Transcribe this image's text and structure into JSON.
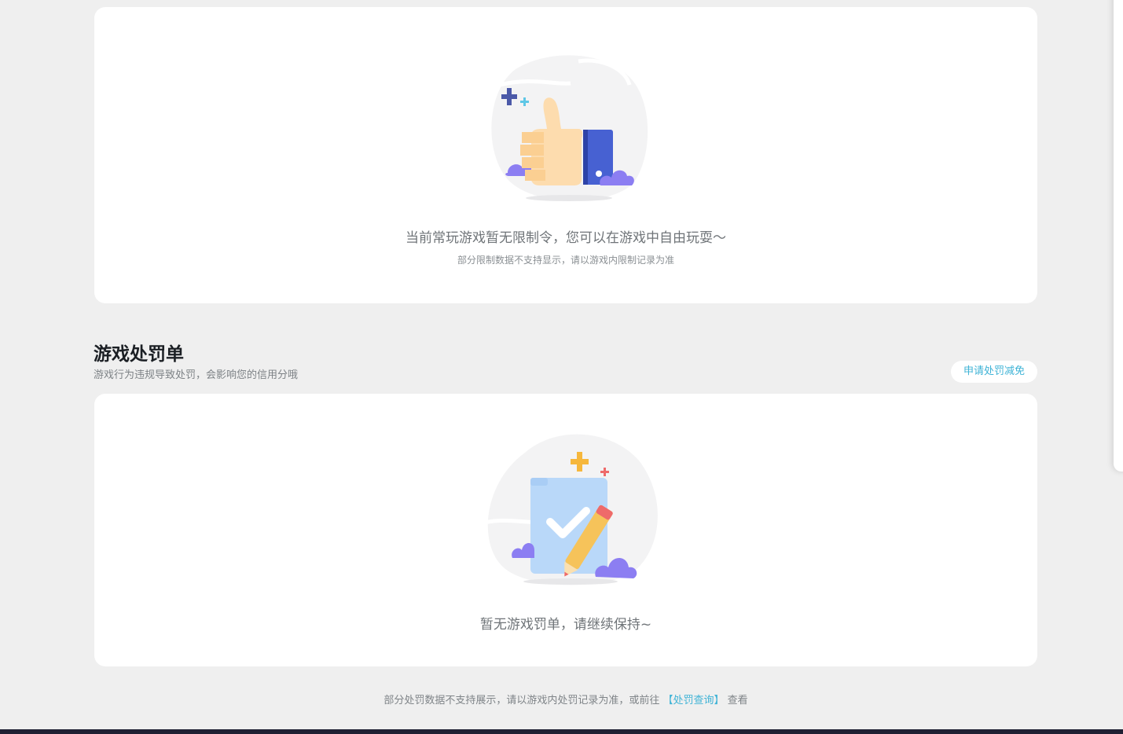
{
  "restriction_card": {
    "illustration": "thumbs-up-illustration",
    "title": "当前常玩游戏暂无限制令，您可以在游戏中自由玩耍～",
    "subtitle": "部分限制数据不支持显示，请以游戏内限制记录为准"
  },
  "penalty_section": {
    "title": "游戏处罚单",
    "description": "游戏行为违规导致处罚，会影响您的信用分哦",
    "appeal_button": "申请处罚减免"
  },
  "penalty_card": {
    "illustration": "checklist-pencil-illustration",
    "title": "暂无游戏罚单，请继续保持~"
  },
  "footer": {
    "prefix": "部分处罚数据不支持展示，请以游戏内处罚记录为准，或前往",
    "link": "【处罚查询】",
    "suffix": "查看"
  },
  "colors": {
    "accent": "#3fb3d6",
    "background": "#efefef",
    "card": "#ffffff"
  }
}
